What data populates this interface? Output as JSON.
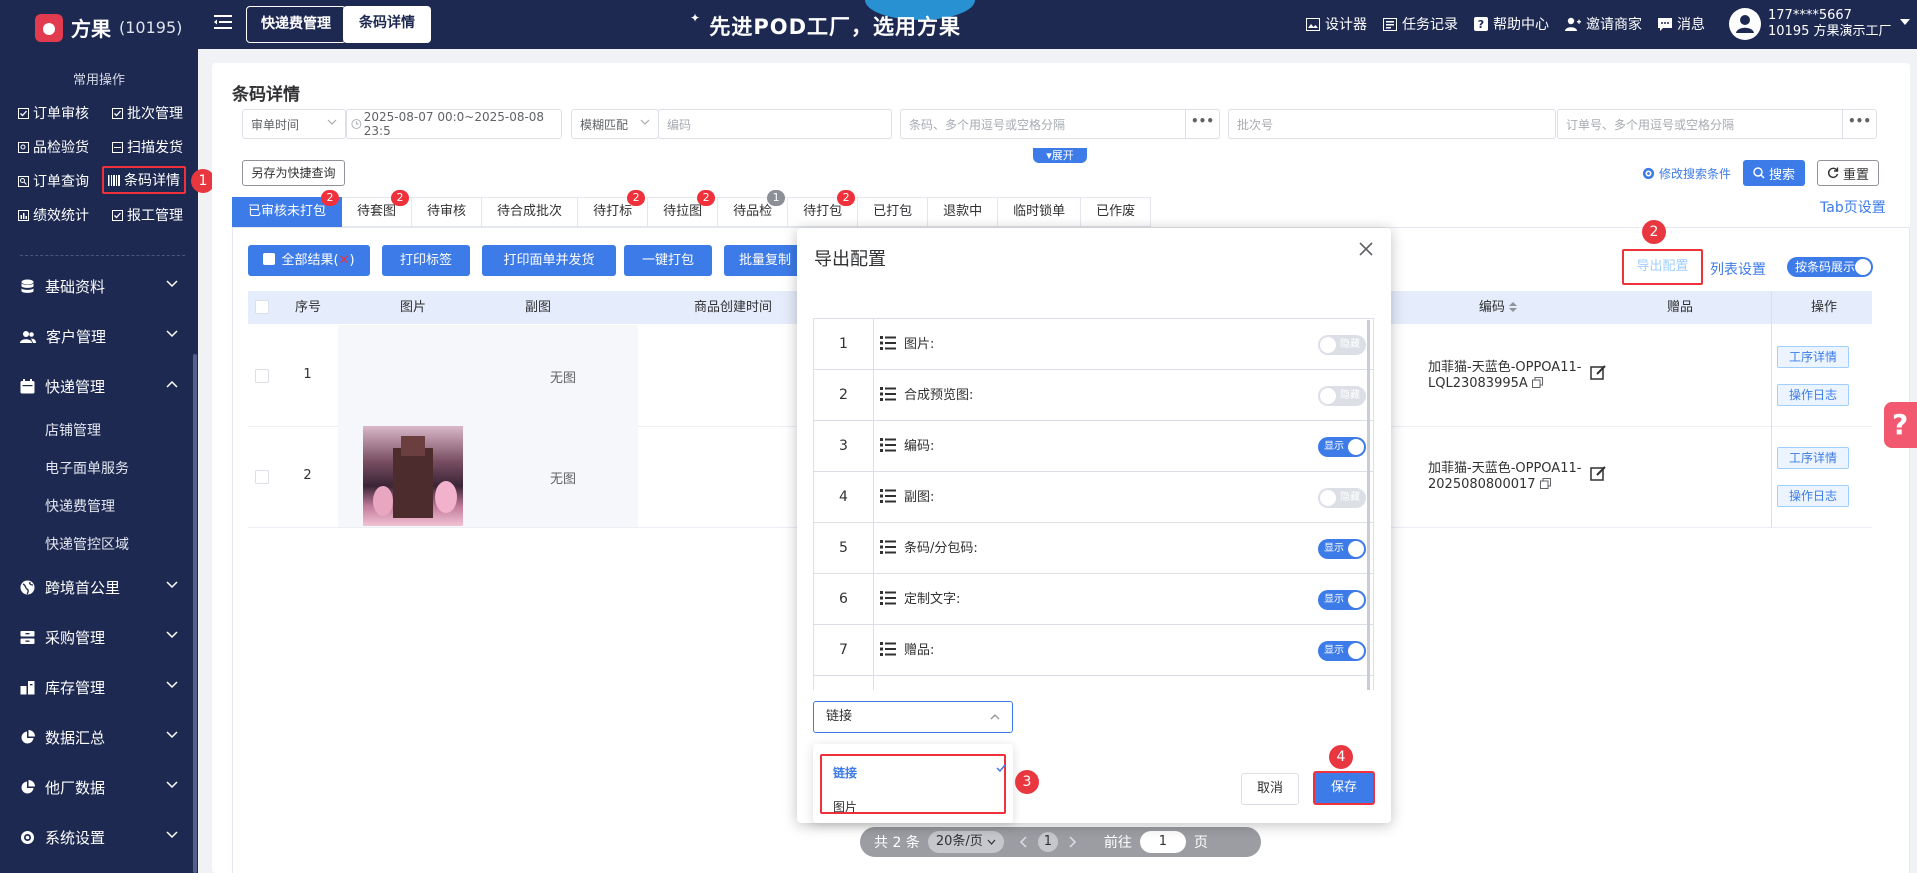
{
  "topbar": {
    "logo_text": "方果",
    "logo_num": "(10195)",
    "tab_express_fee": "快递费管理",
    "tab_barcode_detail": "条码详情",
    "banner": "先进POD工厂，选用方果",
    "links": [
      "设计器",
      "任务记录",
      "帮助中心",
      "邀请商家",
      "消息"
    ],
    "user_phone": "177****5667",
    "user_org": "10195 方果演示工厂"
  },
  "sidebar": {
    "title": "常用操作",
    "quick": [
      "订单审核",
      "批次管理",
      "品检验货",
      "扫描发货",
      "订单查询",
      "条码详情",
      "绩效统计",
      "报工管理"
    ],
    "menus": [
      "基础资料",
      "客户管理",
      "快递管理",
      "跨境首公里",
      "采购管理",
      "库存管理",
      "数据汇总",
      "他厂数据",
      "系统设置"
    ],
    "submenus": [
      "店铺管理",
      "电子面单服务",
      "快递费管理",
      "快递管控区域"
    ]
  },
  "page": {
    "title": "条码详情",
    "filters": {
      "time_type": "审单时间",
      "date_range": "2025-08-07 00:0~2025-08-08 23:5",
      "match_type": "模糊匹配",
      "code_placeholder": "编码",
      "barcode_placeholder": "条码、多个用逗号或空格分隔",
      "batch_placeholder": "批次号",
      "order_placeholder": "订单号、多个用逗号或空格分隔",
      "more": "•••"
    },
    "expand": "▾展开",
    "save_quick_query": "另存为快捷查询",
    "modify_conditions": "修改搜索条件",
    "search": "搜索",
    "reset": "重置",
    "tab_setting": "Tab页设置"
  },
  "tabs": [
    {
      "label": "已审核未打包",
      "badge": "2"
    },
    {
      "label": "待套图",
      "badge": "2"
    },
    {
      "label": "待审核",
      "badge": ""
    },
    {
      "label": "待合成批次",
      "badge": ""
    },
    {
      "label": "待打标",
      "badge": "2"
    },
    {
      "label": "待拉图",
      "badge": "2"
    },
    {
      "label": "待品检",
      "badge": "1"
    },
    {
      "label": "待打包",
      "badge": "2"
    },
    {
      "label": "已打包",
      "badge": ""
    },
    {
      "label": "退款中",
      "badge": ""
    },
    {
      "label": "临时锁单",
      "badge": ""
    },
    {
      "label": "已作废",
      "badge": ""
    }
  ],
  "actions": {
    "all_results": "全部结果(",
    "all_results_x": "✕",
    "all_results_close": ")",
    "print_label": "打印标签",
    "print_ship": "打印面单并发货",
    "one_click_pack": "一键打包",
    "batch_copy": "批量复制",
    "export_config": "导出配置",
    "list_setting": "列表设置",
    "barcode_display": "按条码展示"
  },
  "table": {
    "headers": [
      "序号",
      "图片",
      "副图",
      "商品创建时间",
      "编码",
      "赠品",
      "操作"
    ],
    "rows": [
      {
        "index": "1",
        "sub_image": "无图",
        "code": "加菲猫-天蓝色-OPPOA11-LQL23083995A"
      },
      {
        "index": "2",
        "sub_image": "无图",
        "code": "加菲猫-天蓝色-OPPOA11-2025080800017"
      }
    ],
    "op_detail": "工序详情",
    "op_log": "操作日志"
  },
  "pagination": {
    "total": "共 2 条",
    "page_size": "20条/页",
    "current": "1",
    "goto": "前往",
    "goto_value": "1",
    "page": "页"
  },
  "modal": {
    "title": "导出配置",
    "fields": [
      {
        "num": "1",
        "label": "图片:",
        "on": false
      },
      {
        "num": "2",
        "label": "合成预览图:",
        "on": false
      },
      {
        "num": "3",
        "label": "编码:",
        "on": true
      },
      {
        "num": "4",
        "label": "副图:",
        "on": false
      },
      {
        "num": "5",
        "label": "条码/分包码:",
        "on": true
      },
      {
        "num": "6",
        "label": "定制文字:",
        "on": true
      },
      {
        "num": "7",
        "label": "赠品:",
        "on": true
      }
    ],
    "switch_on": "显示",
    "switch_off": "隐藏",
    "image_type_selected": "链接",
    "options": [
      "链接",
      "图片"
    ],
    "cancel": "取消",
    "save": "保存"
  },
  "steps": [
    "1",
    "2",
    "3",
    "4"
  ],
  "colors": {
    "nav": "#1d2951",
    "primary": "#3d7be8",
    "highlight": "#f0313b"
  }
}
